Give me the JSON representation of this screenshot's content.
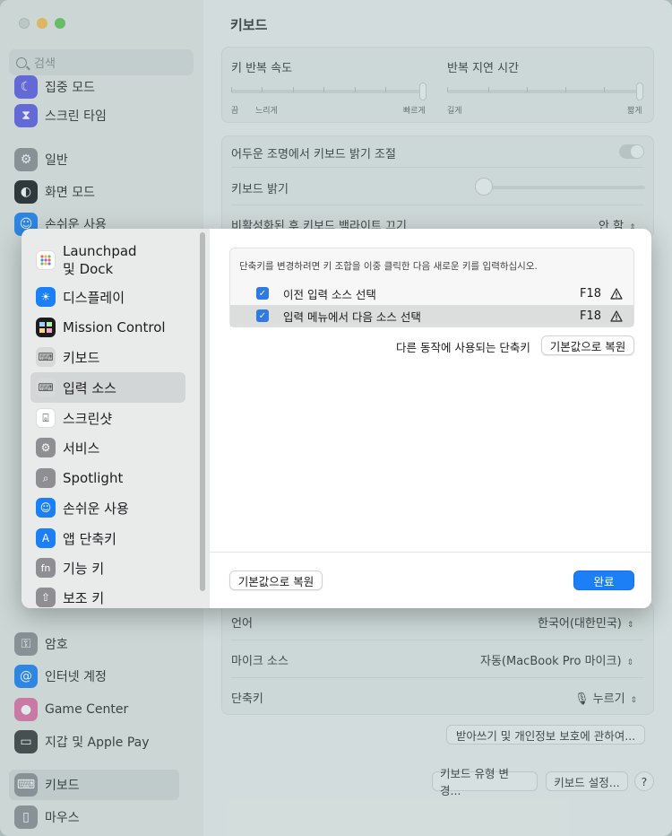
{
  "background": {
    "search_placeholder": "검색",
    "sidebar_items": [
      {
        "label": "집중 모드",
        "icon": "moon-icon",
        "color": "#5e5ce6"
      },
      {
        "label": "스크린 타임",
        "icon": "hourglass-icon",
        "color": "#5e5ce6"
      },
      {
        "label": "일반",
        "icon": "gear-icon",
        "color": "#8e8e93"
      },
      {
        "label": "화면 모드",
        "icon": "appearance-icon",
        "color": "#1c1c1e"
      },
      {
        "label": "손쉬운 사용",
        "icon": "accessibility-icon",
        "color": "#1b7ff5"
      },
      {
        "label": "암호",
        "icon": "key-icon",
        "color": "#8e8e93"
      },
      {
        "label": "인터넷 계정",
        "icon": "at-icon",
        "color": "#1b7ff5"
      },
      {
        "label": "Game Center",
        "icon": "game-center-icon",
        "color": "#e06fa6"
      },
      {
        "label": "지갑 및 Apple Pay",
        "icon": "wallet-icon",
        "color": "#3a3a3c"
      },
      {
        "label": "키보드",
        "icon": "keyboard-icon",
        "color": "#8e8e93"
      },
      {
        "label": "마우스",
        "icon": "mouse-icon",
        "color": "#8e8e93"
      }
    ],
    "title": "키보드",
    "key_repeat_label": "키 반복 속도",
    "key_repeat_min": "끔",
    "key_repeat_slow": "느리게",
    "key_repeat_fast": "빠르게",
    "delay_label": "반복 지연 시간",
    "delay_long": "길게",
    "delay_short": "짧게",
    "low_light_label": "어두운 조명에서 키보드 밝기 조절",
    "brightness_label": "키보드 밝기",
    "backlight_off_label": "비활성화된 후 키보드 백라이트 끄기",
    "backlight_off_value": "안 함",
    "language_label": "언어",
    "language_value": "한국어(대한민국)",
    "mic_label": "마이크 소스",
    "mic_value": "자동(MacBook Pro 마이크)",
    "shortcut_label": "단축키",
    "shortcut_value": "누르기",
    "privacy_button": "받아쓰기 및 개인정보 보호에 관하여...",
    "change_type_button": "키보드 유형 변경...",
    "keyboard_settings_button": "키보드 설정...",
    "help_button": "?"
  },
  "sheet": {
    "categories": [
      {
        "label": "Launchpad\n및 Dock",
        "icon": "launchpad-icon",
        "color": "#ffffff"
      },
      {
        "label": "디스플레이",
        "icon": "display-icon",
        "color": "#1b7ff5"
      },
      {
        "label": "Mission Control",
        "icon": "mission-control-icon",
        "color": "#1c1c1e"
      },
      {
        "label": "키보드",
        "icon": "keyboard-icon",
        "color": "#8e8e93"
      },
      {
        "label": "입력 소스",
        "icon": "input-source-icon",
        "color": "#8e8e93"
      },
      {
        "label": "스크린샷",
        "icon": "screenshot-icon",
        "color": "#ffffff"
      },
      {
        "label": "서비스",
        "icon": "services-icon",
        "color": "#8e8e93"
      },
      {
        "label": "Spotlight",
        "icon": "spotlight-icon",
        "color": "#8e8e93"
      },
      {
        "label": "손쉬운 사용",
        "icon": "accessibility-icon",
        "color": "#1b7ff5"
      },
      {
        "label": "앱 단축키",
        "icon": "app-store-icon",
        "color": "#1b7ff5"
      },
      {
        "label": "기능 키",
        "icon": "fn-icon",
        "color": "#8e8e93"
      },
      {
        "label": "보조 키",
        "icon": "modifier-keys-icon",
        "color": "#8e8e93"
      }
    ],
    "selected_category": "입력 소스",
    "hint": "단축키를 변경하려면 키 조합을 이중 클릭한 다음 새로운 키를 입력하십시오.",
    "shortcuts": [
      {
        "label": "이전 입력 소스 선택",
        "key": "F18",
        "checked": true
      },
      {
        "label": "입력 메뉴에서 다음 소스 선택",
        "key": "F18",
        "checked": true
      }
    ],
    "conflict_label": "다른 동작에 사용되는 단축키",
    "restore_defaults_inline": "기본값으로 복원",
    "restore_defaults": "기본값으로 복원",
    "done": "완료"
  }
}
